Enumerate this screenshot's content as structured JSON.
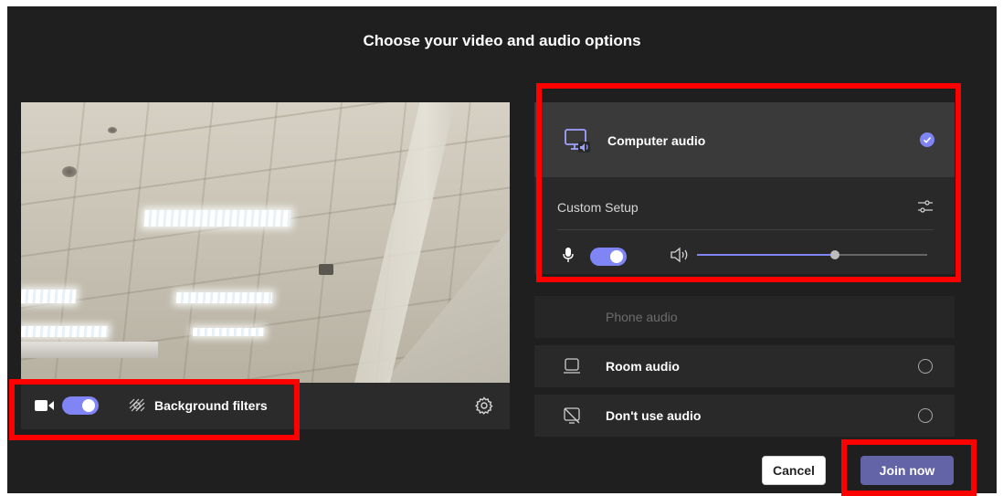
{
  "dialog": {
    "title": "Choose your video and audio options"
  },
  "video": {
    "camera_on": true,
    "background_filters_label": "Background filters"
  },
  "audio": {
    "selected": {
      "label": "Computer audio",
      "setup_label": "Custom Setup",
      "mic_on": true,
      "speaker_volume": 0.6
    },
    "options": [
      {
        "label": "Phone audio",
        "disabled": true
      },
      {
        "label": "Room audio"
      },
      {
        "label": "Don't use audio"
      }
    ]
  },
  "actions": {
    "cancel_label": "Cancel",
    "join_label": "Join now"
  },
  "colors": {
    "background": "#1f1f1f",
    "accent": "#7f85f5",
    "join_button": "#6264a7",
    "highlight": "#ff0000"
  }
}
